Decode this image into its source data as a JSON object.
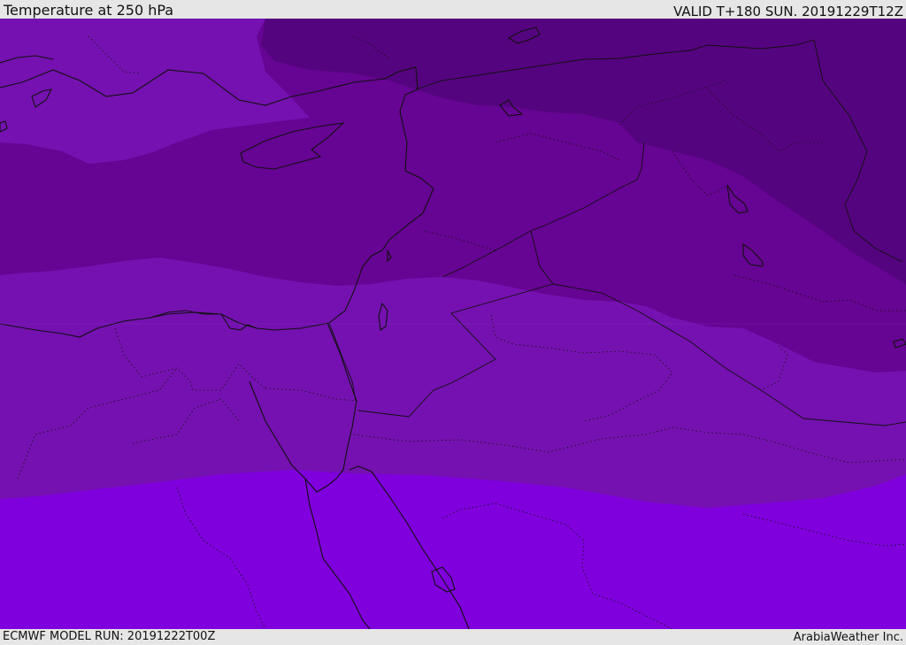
{
  "header": {
    "title": "Temperature at 250 hPa",
    "valid": "VALID T+180 SUN. 20191229T12Z"
  },
  "footer": {
    "model_run": "ECMWF MODEL RUN: 20191222T00Z",
    "credit": "ArabiaWeather Inc."
  },
  "map": {
    "field": "Temperature at 250 hPa",
    "bands": [
      {
        "name": "darkest-band",
        "color": "#55047f"
      },
      {
        "name": "dark-band",
        "color": "#660493"
      },
      {
        "name": "mid-band",
        "color": "#7511b0"
      },
      {
        "name": "warm-band",
        "color": "#7f00dc"
      }
    ],
    "coastline_color": "#111111",
    "border_style": "dotted"
  }
}
